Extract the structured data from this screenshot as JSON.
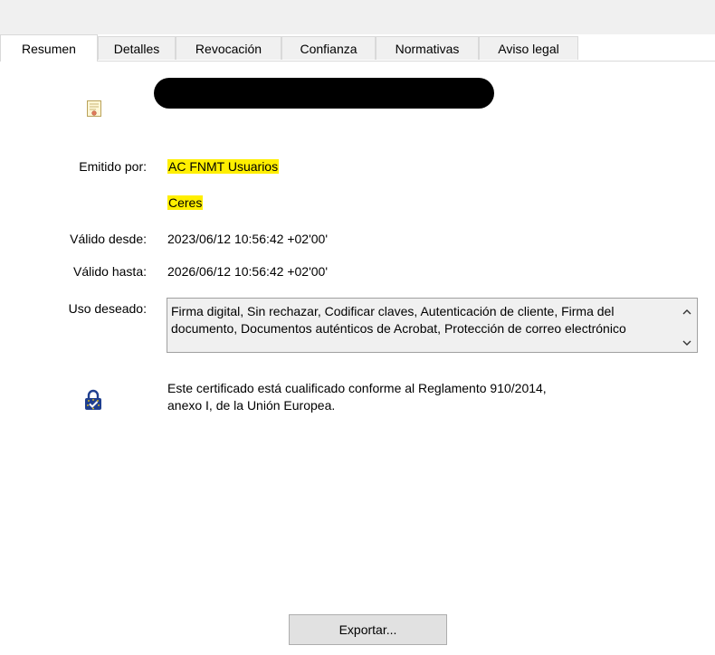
{
  "tabs": [
    {
      "label": "Resumen",
      "active": true
    },
    {
      "label": "Detalles",
      "active": false
    },
    {
      "label": "Revocación",
      "active": false
    },
    {
      "label": "Confianza",
      "active": false
    },
    {
      "label": "Normativas",
      "active": false
    },
    {
      "label": "Aviso legal",
      "active": false
    }
  ],
  "summary": {
    "issued_by_label": "Emitido por:",
    "issued_by_line1": "AC FNMT Usuarios",
    "issued_by_line2": "Ceres",
    "valid_from_label": "Válido desde:",
    "valid_from_value": "2023/06/12 10:56:42 +02'00'",
    "valid_to_label": "Válido hasta:",
    "valid_to_value": "2026/06/12 10:56:42 +02'00'",
    "intended_use_label": "Uso deseado:",
    "intended_use_value": "Firma digital, Sin rechazar, Codificar claves, Autenticación de cliente, Firma del documento, Documentos auténticos de Acrobat, Protección de correo electrónico",
    "qualified_line1": "Este certificado está cualificado conforme al Reglamento 910/2014,",
    "qualified_line2": "anexo I, de la Unión Europea."
  },
  "footer": {
    "export_label": "Exportar..."
  },
  "colors": {
    "highlight": "#ffef00",
    "tab_background": "#f0f0f0",
    "redaction": "#000000"
  },
  "icons": {
    "certificate": "certificate-icon",
    "qualified": "eu-trust-lock-icon",
    "scroll_up": "chevron-up-icon",
    "scroll_down": "chevron-down-icon"
  }
}
